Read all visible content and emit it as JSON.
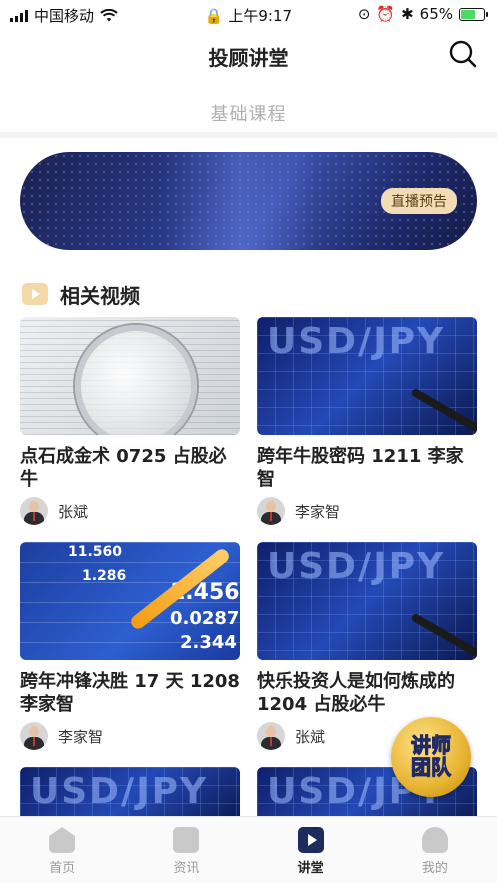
{
  "status": {
    "carrier": "中国移动",
    "time": "上午9:17",
    "battery": "65%"
  },
  "header": {
    "title": "投顾讲堂"
  },
  "subtab": {
    "label": "基础课程"
  },
  "banner": {
    "tag": "直播预告"
  },
  "section": {
    "title": "相关视频"
  },
  "videos": [
    {
      "title": "点石成金术 0725 占股必牛",
      "author": "张斌"
    },
    {
      "title": "跨年牛股密码 1211 李家智",
      "author": "李家智"
    },
    {
      "title": "跨年冲锋决胜 17 天 1208 李家智",
      "author": "李家智"
    },
    {
      "title": " 快乐投资人是如何炼成的 1204 占股必牛",
      "author": "张斌"
    }
  ],
  "thumb_text": {
    "usd": "USD/JPY",
    "stock_a": "11.560",
    "stock_b": "1.286",
    "stock_c": "1.4563",
    "stock_d": "0.0287",
    "stock_e": "2.344"
  },
  "float_badge": {
    "line1": "讲师",
    "line2": "团队"
  },
  "tabbar": {
    "items": [
      {
        "label": "首页"
      },
      {
        "label": "资讯"
      },
      {
        "label": "讲堂"
      },
      {
        "label": "我的"
      }
    ],
    "active_index": 2
  }
}
